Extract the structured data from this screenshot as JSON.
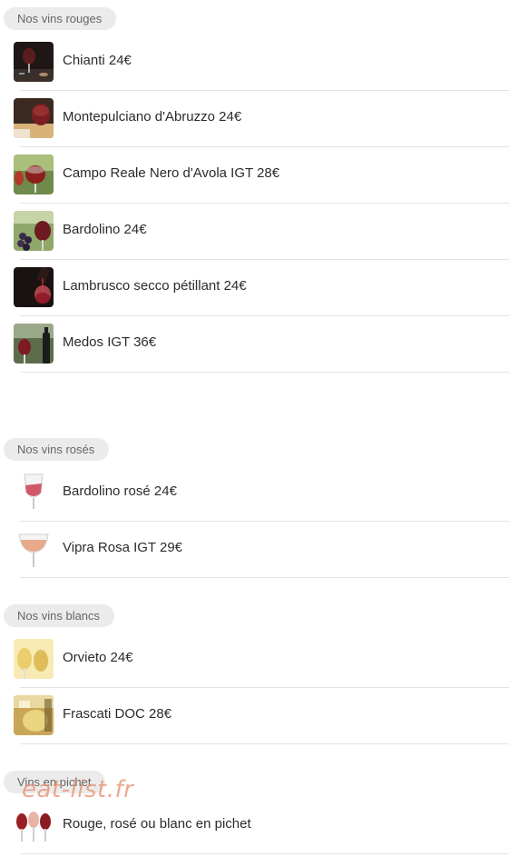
{
  "sections": [
    {
      "title": "Nos vins rouges",
      "items": [
        {
          "label": "Chianti 24€",
          "icon": "red-wine-glass-dark-photo"
        },
        {
          "label": "Montepulciano d'Abruzzo 24€",
          "icon": "red-wine-glass-photo"
        },
        {
          "label": "Campo Reale Nero d'Avola IGT 28€",
          "icon": "red-wine-glasses-photo"
        },
        {
          "label": "Bardolino 24€",
          "icon": "grapes-and-wine-photo"
        },
        {
          "label": "Lambrusco secco pétillant 24€",
          "icon": "pouring-red-wine-photo"
        },
        {
          "label": "Medos IGT 36€",
          "icon": "red-wine-bottle-glass-photo"
        }
      ]
    },
    {
      "title": "Nos vins rosés",
      "items": [
        {
          "label": "Bardolino rosé 24€",
          "icon": "rose-wine-glass"
        },
        {
          "label": "Vipra Rosa IGT 29€",
          "icon": "rose-wine-glass-light"
        }
      ]
    },
    {
      "title": "Nos vins blancs",
      "items": [
        {
          "label": "Orvieto 24€",
          "icon": "white-wine-glasses-photo"
        },
        {
          "label": "Frascati DOC 28€",
          "icon": "white-wine-pour-photo"
        }
      ]
    },
    {
      "title": "Vins en pichet",
      "items": [
        {
          "label": "Rouge, rosé ou blanc en pichet",
          "icon": "three-wine-glasses-photo"
        }
      ]
    }
  ],
  "watermark": "eat-list.fr"
}
